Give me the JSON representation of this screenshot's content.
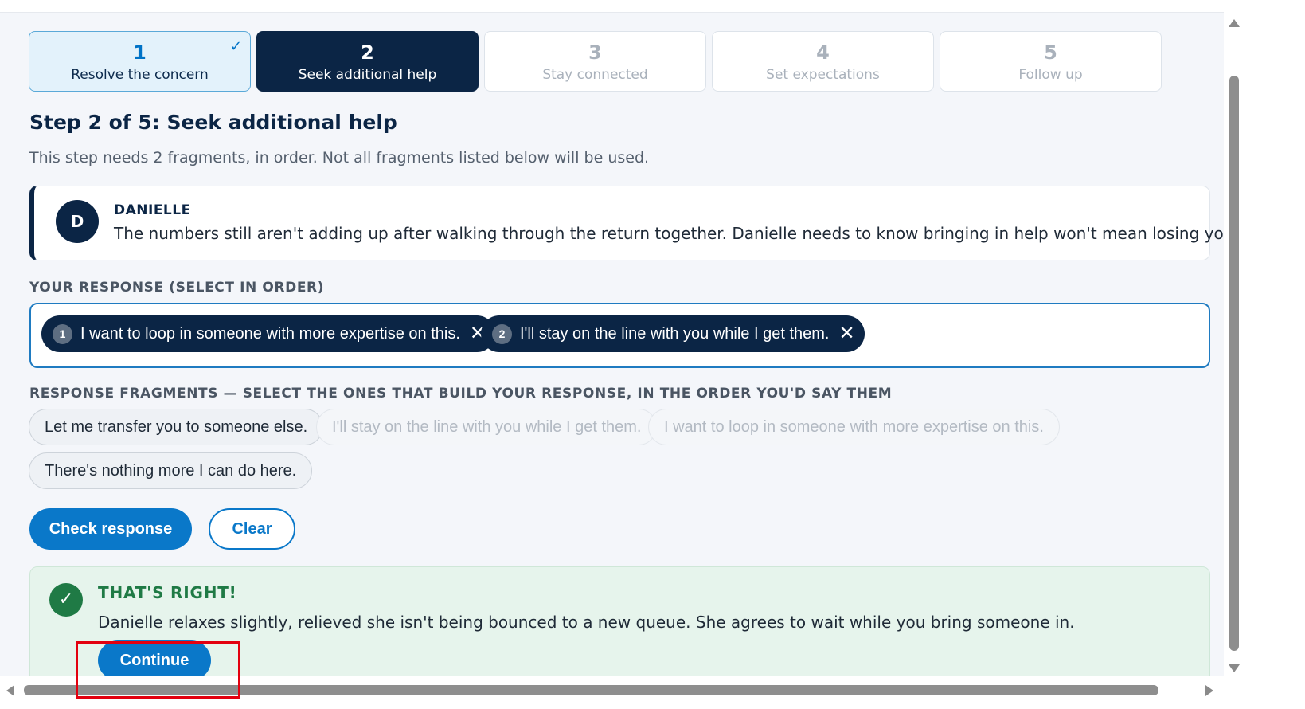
{
  "stepper": [
    {
      "number": "1",
      "label": "Resolve the concern",
      "state": "done",
      "check": "✓"
    },
    {
      "number": "2",
      "label": "Seek additional help",
      "state": "active"
    },
    {
      "number": "3",
      "label": "Stay connected",
      "state": "upcoming"
    },
    {
      "number": "4",
      "label": "Set expectations",
      "state": "upcoming"
    },
    {
      "number": "5",
      "label": "Follow up",
      "state": "upcoming"
    }
  ],
  "step": {
    "title": "Step 2 of 5: Seek additional help",
    "description": "This step needs 2 fragments, in order. Not all fragments listed below will be used."
  },
  "customer": {
    "initial": "D",
    "name": "DANIELLE",
    "message": "The numbers still aren't adding up after walking through the return together. Danielle needs to know bringing in help won't mean losing you."
  },
  "response": {
    "label": "YOUR RESPONSE (SELECT IN ORDER)",
    "selected": [
      {
        "index": "1",
        "text": "I want to loop in someone with more expertise on this.",
        "remove": "✕"
      },
      {
        "index": "2",
        "text": "I'll stay on the line with you while I get them.",
        "remove": "✕"
      }
    ]
  },
  "fragments": {
    "label": "RESPONSE FRAGMENTS — SELECT THE ONES THAT BUILD YOUR RESPONSE, IN THE ORDER YOU'D SAY THEM",
    "items": [
      {
        "text": "Let me transfer you to someone else.",
        "used": false
      },
      {
        "text": "I'll stay on the line with you while I get them.",
        "used": true
      },
      {
        "text": "I want to loop in someone with more expertise on this.",
        "used": true
      },
      {
        "text": "There's nothing more I can do here.",
        "used": false
      }
    ]
  },
  "actions": {
    "check_label": "Check response",
    "clear_label": "Clear"
  },
  "feedback": {
    "icon": "✓",
    "title": "THAT'S RIGHT!",
    "text": "Danielle relaxes slightly, relieved she isn't being bounced to a new queue. She agrees to wait while you bring someone in.",
    "continue_label": "Continue"
  },
  "colors": {
    "navy": "#0b2545",
    "primary_blue": "#0a78c9",
    "success_green": "#1f7a45",
    "success_bg": "#e6f4ec",
    "highlight_red": "#e3000f"
  }
}
